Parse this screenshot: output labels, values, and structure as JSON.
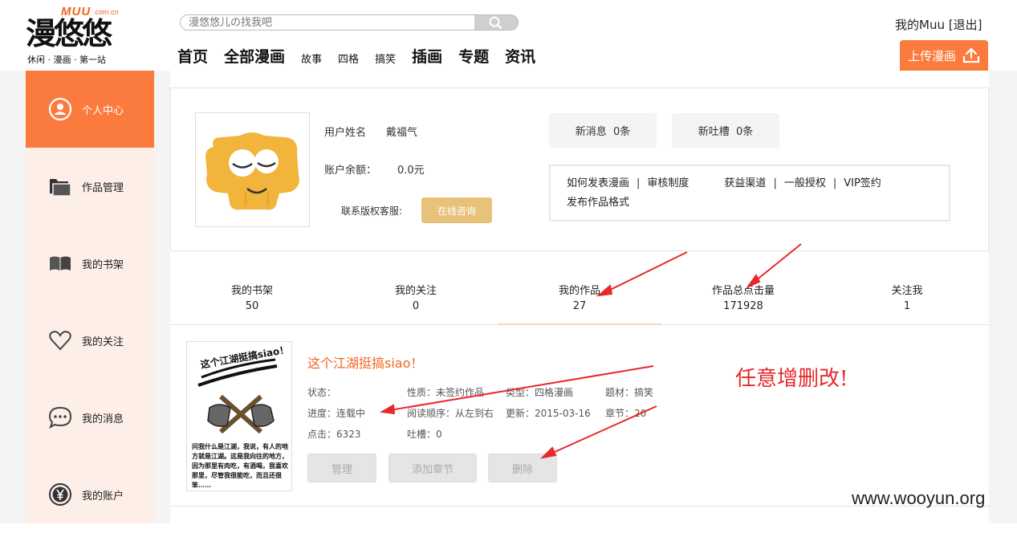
{
  "header": {
    "logo": {
      "brand": "MUU",
      "domain": ".com.cn",
      "title": "漫悠悠",
      "slogan": "休闲 · 漫画 · 第一站"
    },
    "search": {
      "placeholder": "漫悠悠儿の找我吧",
      "icon": "search-icon"
    },
    "nav": [
      "首页",
      "全部漫画",
      "故事",
      "四格",
      "搞笑",
      "插画",
      "专题",
      "资讯"
    ],
    "user": {
      "greeting": "我的Muu",
      "logout": "[退出]"
    },
    "upload_label": "上传漫画"
  },
  "sidebar": {
    "items": [
      {
        "label": "个人中心",
        "icon": "user-circle-icon",
        "active": true
      },
      {
        "label": "作品管理",
        "icon": "folder-icon"
      },
      {
        "label": "我的书架",
        "icon": "book-icon"
      },
      {
        "label": "我的关注",
        "icon": "heart-icon"
      },
      {
        "label": "我的消息",
        "icon": "chat-bubble-icon"
      },
      {
        "label": "我的账户",
        "icon": "yen-coin-icon"
      }
    ]
  },
  "profile": {
    "username_label": "用户姓名",
    "username": "戴福气",
    "balance_label": "账户余额：",
    "balance": "0.0元",
    "service_label": "联系版权客服:",
    "consult_button": "在线咨询",
    "new_messages": {
      "label": "新消息",
      "count": "0条"
    },
    "new_comments": {
      "label": "新吐槽",
      "count": "0条"
    },
    "links": [
      "如何发表漫画",
      "审核制度",
      "获益渠道",
      "一般授权",
      "VIP签约",
      "发布作品格式"
    ]
  },
  "stats": [
    {
      "label": "我的书架",
      "value": "50"
    },
    {
      "label": "我的关注",
      "value": "0"
    },
    {
      "label": "我的作品",
      "value": "27"
    },
    {
      "label": "作品总点击量",
      "value": "171928"
    },
    {
      "label": "关注我",
      "value": "1"
    }
  ],
  "work": {
    "title": "这个江湖挺搞siao！",
    "cover_title": "这个江湖挺搞siao！",
    "cover_text": "问我什么是江湖，我说，有人的地方就是江湖。这是我向往的地方，因为那里有肉吃，有酒喝，我喜欢那里，尽管我很能吃，而且还很笨……",
    "info": {
      "status": "状态：",
      "nature": "性质：未签约作品",
      "type": "类型：四格漫画",
      "theme": "题材：搞笑",
      "progress": "进度：连载中",
      "order": "阅读顺序：从左到右",
      "updated": "更新：2015-03-16",
      "chapters": "章节：20",
      "clicks": "点击：6323",
      "comments": "吐槽：0"
    },
    "buttons": {
      "manage": "管理",
      "add_chapter": "添加章节",
      "delete": "删除"
    }
  },
  "annotation": "任意增删改!",
  "watermark": "www.wooyun.org",
  "colors": {
    "accent": "#fa7b3d",
    "title": "#f26522",
    "gold": "#e8c27a",
    "annotation": "#e8282b"
  }
}
